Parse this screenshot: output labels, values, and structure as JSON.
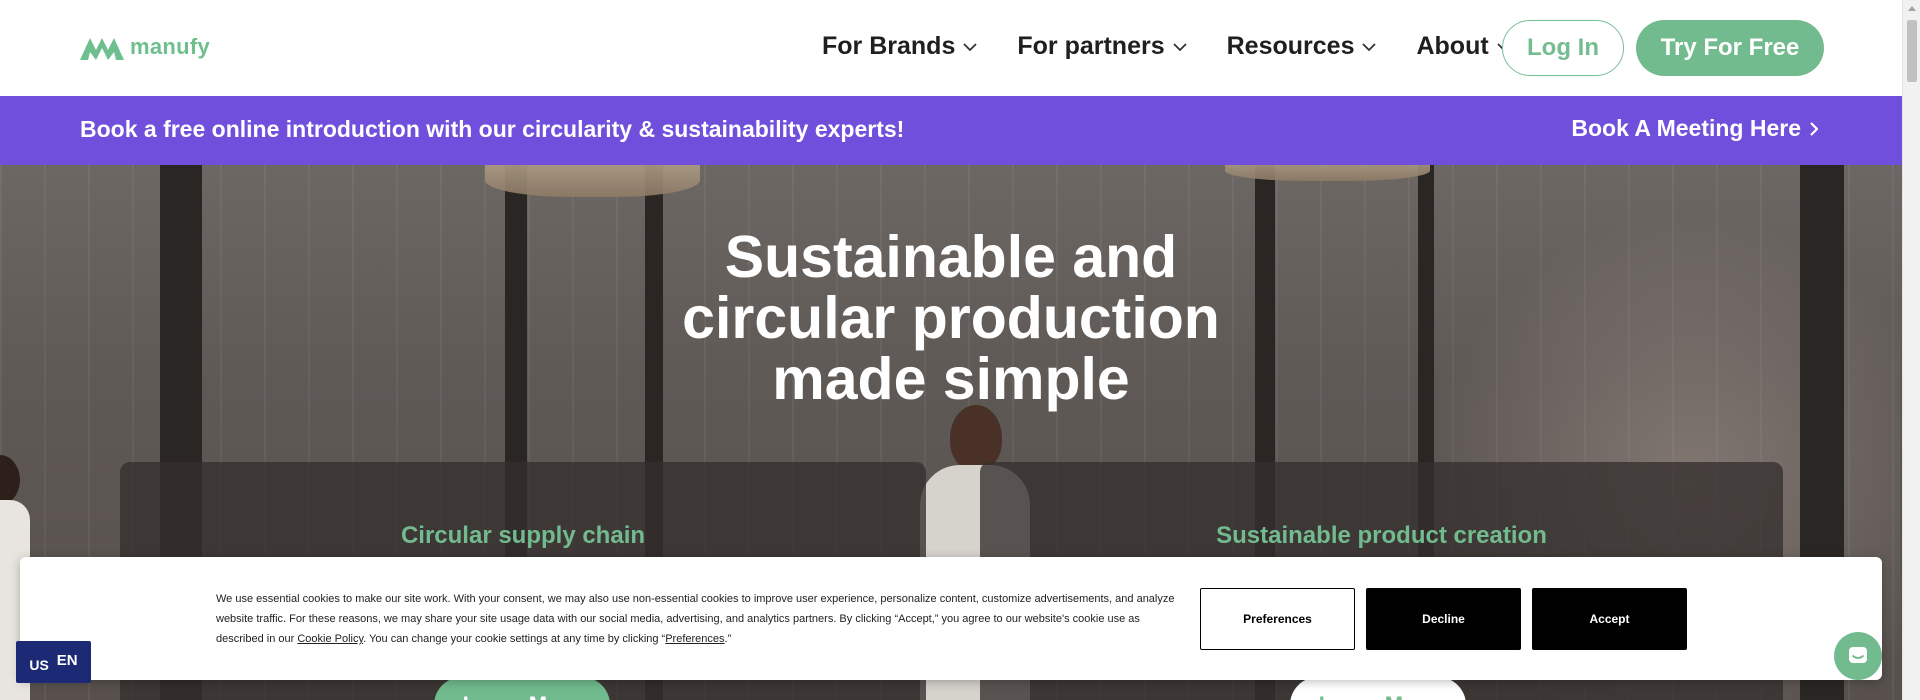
{
  "header": {
    "logo_text": "manufy",
    "nav": [
      {
        "label": "For Brands"
      },
      {
        "label": "For partners"
      },
      {
        "label": "Resources"
      },
      {
        "label": "About"
      }
    ],
    "login_label": "Log In",
    "try_label": "Try For Free"
  },
  "banner": {
    "text": "Book a free online introduction with our circularity & sustainability experts!",
    "link_label": "Book A Meeting Here",
    "color": "#704fdc"
  },
  "hero": {
    "title_line1": "Sustainable and",
    "title_line2": "circular production",
    "title_line3": "made simple",
    "cards": [
      {
        "title": "Circular supply chain",
        "button": "Learn More"
      },
      {
        "title": "Sustainable product creation",
        "button": "Learn More"
      }
    ]
  },
  "cookie": {
    "text_part1": "We use essential cookies to make our site work. With your consent, we may also use non-essential cookies to improve user experience, personalize content, customize advertisements, and analyze website traffic. For these reasons, we may share your site usage data with our social media, advertising, and analytics partners. By clicking “Accept,” you agree to our website's cookie use as described in our ",
    "policy_link": "Cookie Policy",
    "text_part2": ". You can change your cookie settings at any time by clicking “",
    "preferences_link": "Preferences",
    "text_part3": ".”",
    "preferences_button": "Preferences",
    "decline_button": "Decline",
    "accept_button": "Accept"
  },
  "language": {
    "flag": "US",
    "code": "EN"
  },
  "colors": {
    "accent_green": "#72bb8e",
    "banner_purple": "#704fdc",
    "lang_badge": "#1c2a75"
  },
  "icons": {
    "chevron": "chevron-down-icon",
    "arrow": "chevron-right-icon",
    "chat": "chat-icon"
  }
}
